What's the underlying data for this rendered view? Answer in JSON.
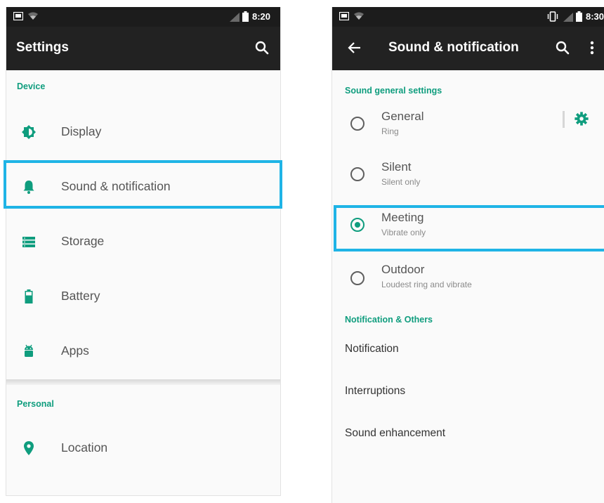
{
  "left_screen": {
    "status_bar": {
      "time": "8:20",
      "icons": [
        "screenshot-icon",
        "wifi-icon",
        "signal-icon",
        "battery-icon"
      ]
    },
    "app_bar": {
      "title": "Settings",
      "search_icon": "search-icon"
    },
    "sections": [
      {
        "header": "Device",
        "items": [
          {
            "label": "Display",
            "icon": "brightness-icon"
          },
          {
            "label": "Sound & notification",
            "icon": "bell-icon",
            "highlighted": true
          },
          {
            "label": "Storage",
            "icon": "storage-icon"
          },
          {
            "label": "Battery",
            "icon": "battery-icon"
          },
          {
            "label": "Apps",
            "icon": "android-icon"
          }
        ]
      },
      {
        "header": "Personal",
        "items": [
          {
            "label": "Location",
            "icon": "location-pin-icon"
          }
        ]
      }
    ]
  },
  "right_screen": {
    "status_bar": {
      "time": "8:30",
      "icons": [
        "screenshot-icon",
        "wifi-icon",
        "vibrate-icon",
        "signal-icon",
        "battery-icon"
      ]
    },
    "app_bar": {
      "title": "Sound & notification",
      "back_icon": "back-arrow-icon",
      "search_icon": "search-icon",
      "overflow_icon": "more-vert-icon"
    },
    "sound_section": {
      "header": "Sound general settings",
      "profiles": [
        {
          "name": "General",
          "subtitle": "Ring",
          "selected": false,
          "has_settings": true
        },
        {
          "name": "Silent",
          "subtitle": "Silent only",
          "selected": false
        },
        {
          "name": "Meeting",
          "subtitle": "Vibrate only",
          "selected": true,
          "highlighted": true
        },
        {
          "name": "Outdoor",
          "subtitle": "Loudest ring and vibrate",
          "selected": false
        }
      ]
    },
    "notification_section": {
      "header": "Notification & Others",
      "items": [
        "Notification",
        "Interruptions",
        "Sound enhancement"
      ]
    }
  },
  "colors": {
    "accent": "#0f9d7e",
    "highlight": "#1fb4e6",
    "app_bar": "#222222",
    "status_bar": "#1c1c1c"
  }
}
